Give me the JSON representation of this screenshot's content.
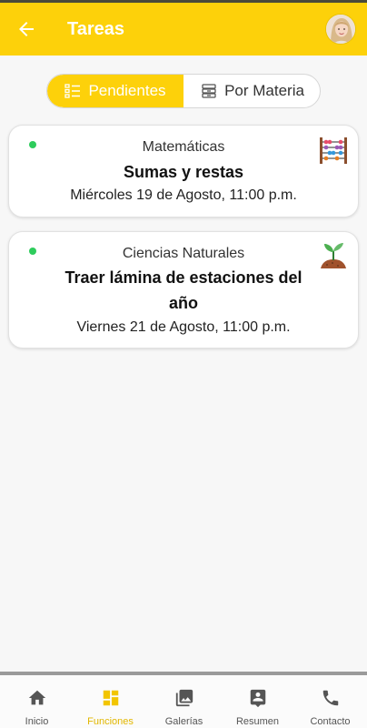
{
  "header": {
    "title": "Tareas"
  },
  "tabs": {
    "pending_label": "Pendientes",
    "by_subject_label": "Por Materia"
  },
  "tasks": [
    {
      "subject": "Matemáticas",
      "title": "Sumas y restas",
      "due": "Miércoles 19 de Agosto, 11:00 p.m.",
      "icon": "abacus-icon"
    },
    {
      "subject": "Ciencias Naturales",
      "title_line1": "Traer lámina de estaciones del",
      "title_line2": "año",
      "due": "Viernes 21 de Agosto, 11:00 p.m.",
      "icon": "plant-sprout-icon"
    }
  ],
  "nav": {
    "home": "Inicio",
    "functions": "Funciones",
    "gallery": "Galerías",
    "summary": "Resumen",
    "contact": "Contacto"
  },
  "colors": {
    "accent": "#fdd10a",
    "status_dot": "#2ecc5c",
    "active_nav": "#e2b700"
  }
}
